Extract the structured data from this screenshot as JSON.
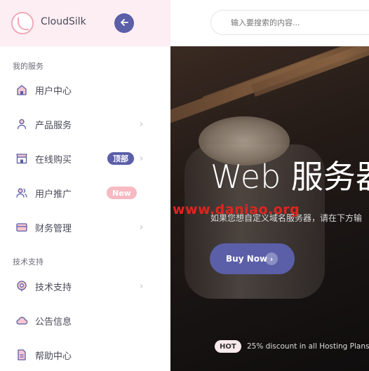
{
  "brand": {
    "name": "CloudSilk",
    "back_icon": "arrow-left-icon"
  },
  "search": {
    "placeholder": "输入要搜索的内容..."
  },
  "sidebar": {
    "sections": [
      {
        "title": "我的服务"
      },
      {
        "title": "技术支持"
      }
    ],
    "items": [
      {
        "label": "用户中心",
        "icon": "home-icon"
      },
      {
        "label": "产品服务",
        "icon": "user-icon"
      },
      {
        "label": "在线购买",
        "icon": "store-icon",
        "badge": "顶部"
      },
      {
        "label": "用户推广",
        "icon": "users-icon",
        "badge": "New"
      },
      {
        "label": "财务管理",
        "icon": "card-icon"
      },
      {
        "label": "技术支持",
        "icon": "support-icon"
      },
      {
        "label": "公告信息",
        "icon": "cloud-icon"
      },
      {
        "label": "帮助中心",
        "icon": "document-icon"
      }
    ]
  },
  "hero": {
    "title": "Web 服务器",
    "subtitle": "如果您想自定义域名服务器，请在下方输",
    "watermark": "www.daniao.org",
    "buy_label": "Buy Now",
    "hot_label": "HOT",
    "promo_text": "25% discount in all Hosting Plans"
  },
  "colors": {
    "accent": "#5b5fa8",
    "pink": "#f2a9b8",
    "sidebar_header": "#fdeef3"
  }
}
